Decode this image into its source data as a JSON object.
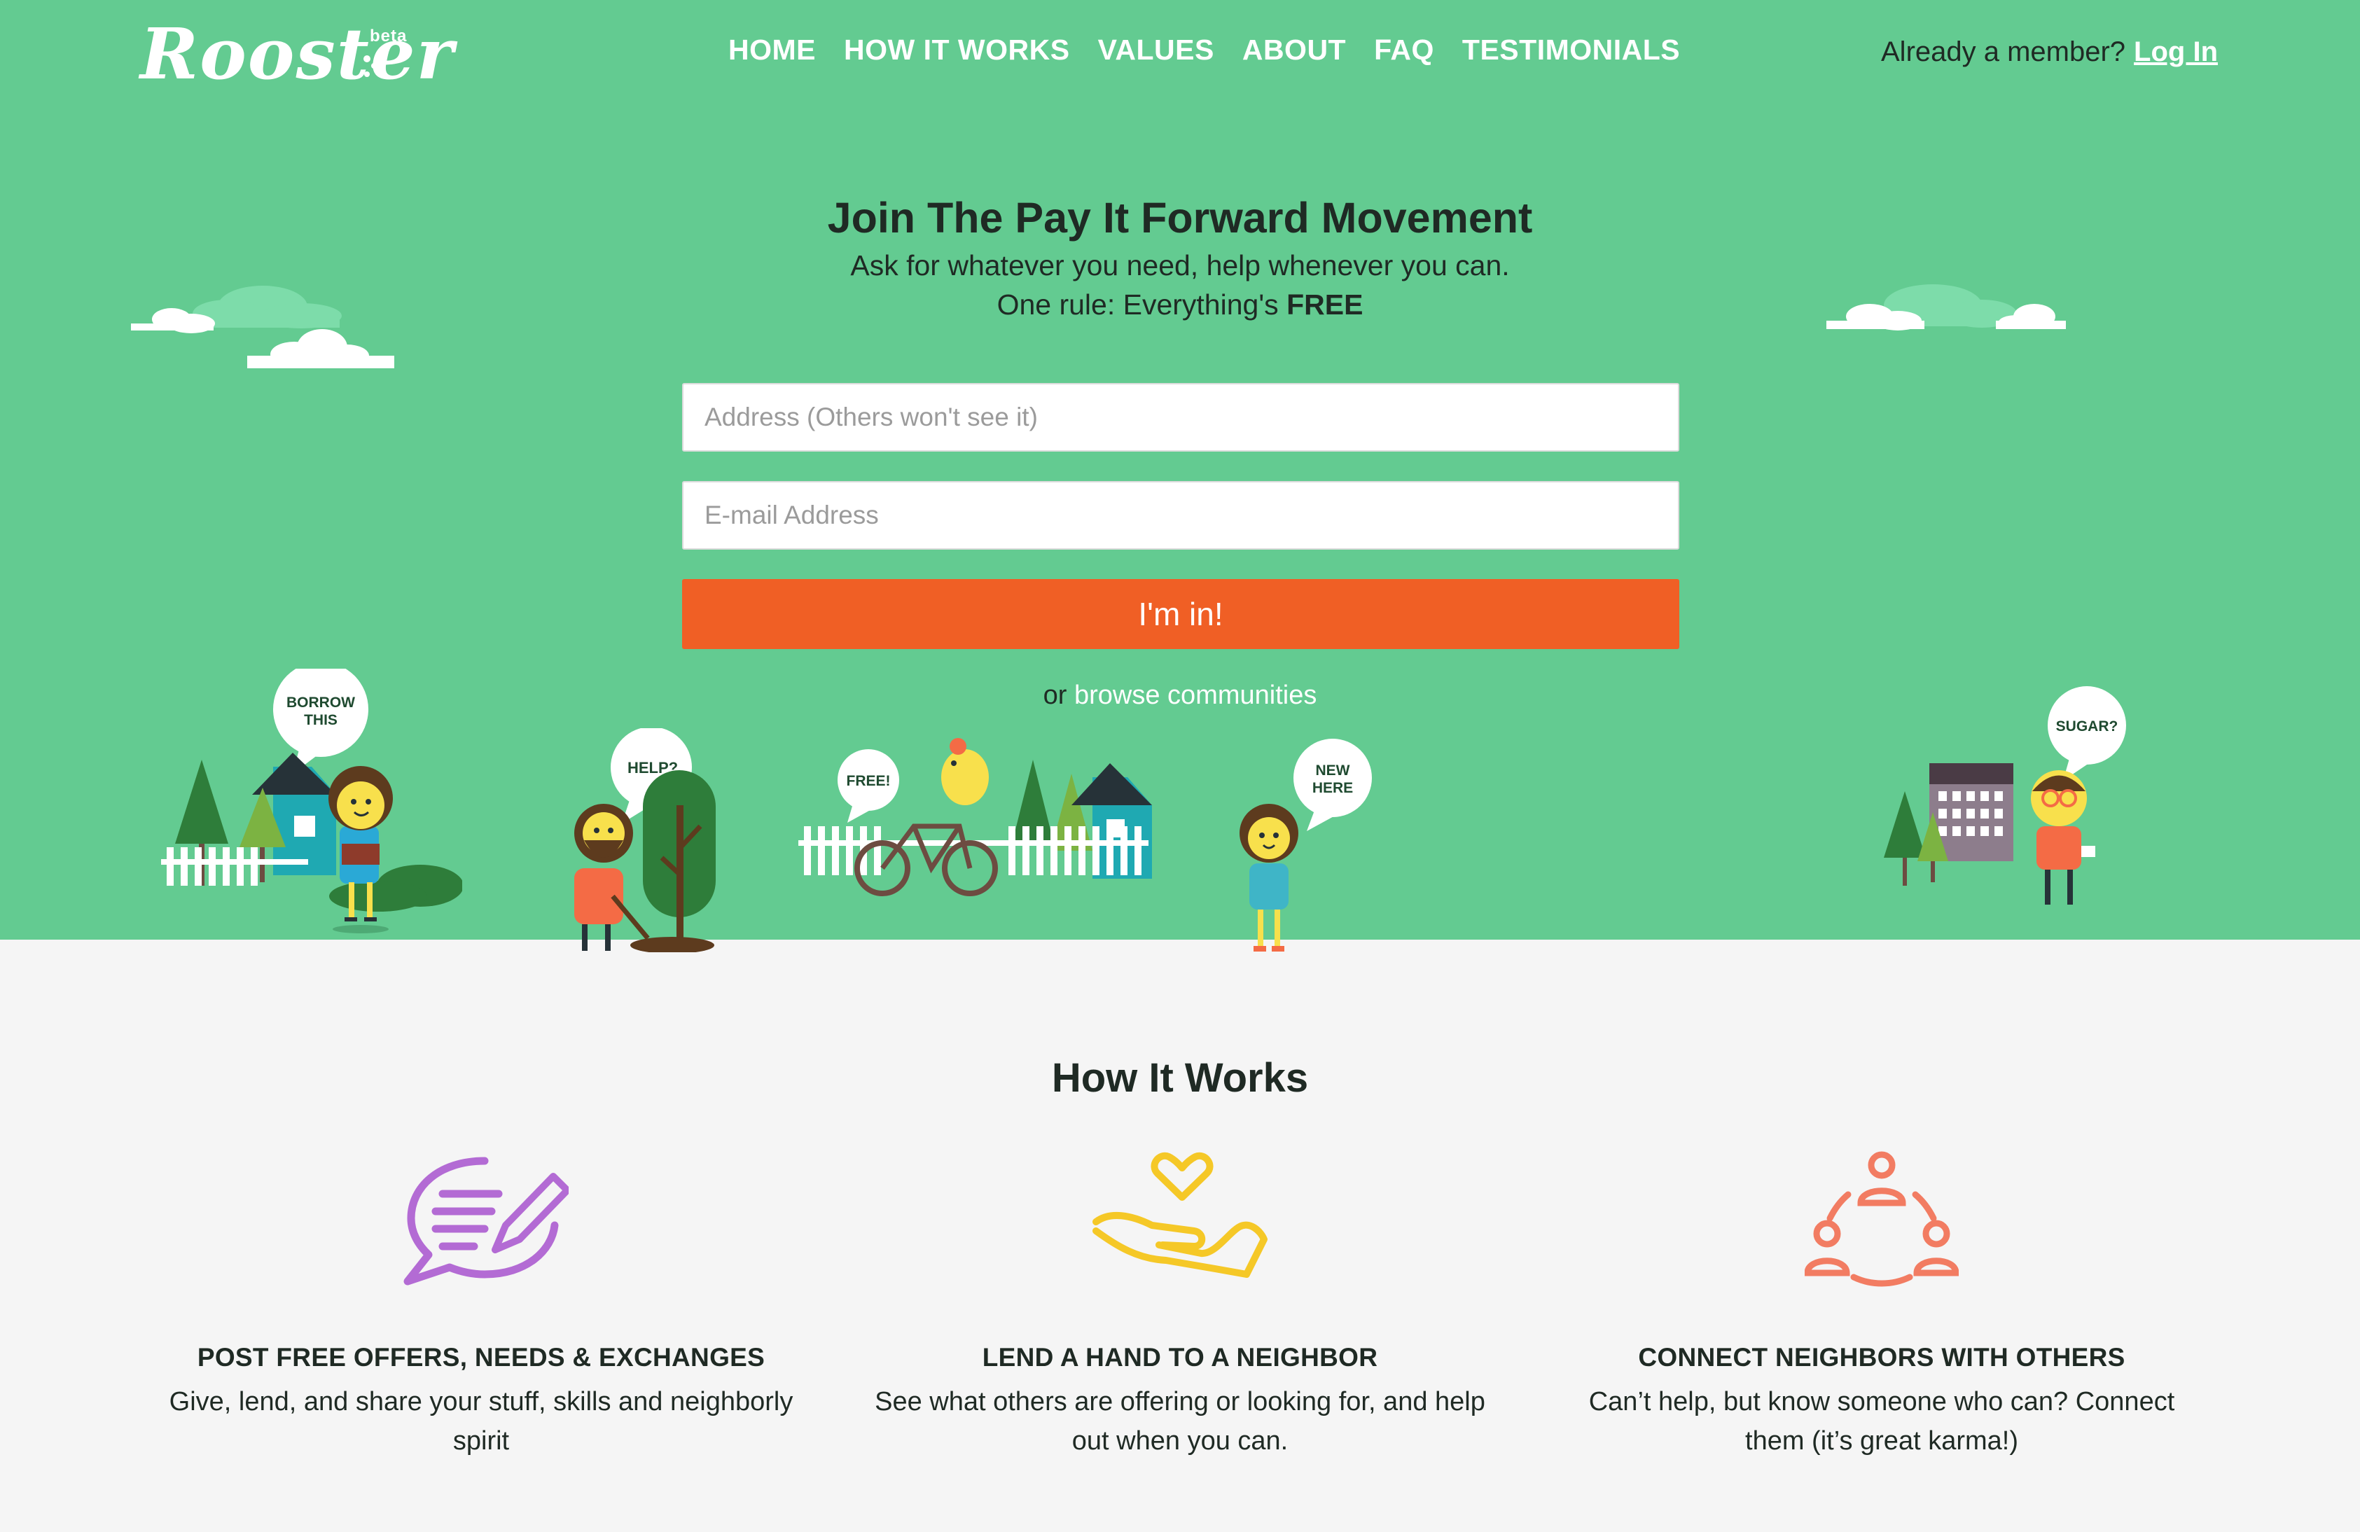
{
  "brand": {
    "name": "Rooster",
    "badge": "beta"
  },
  "nav": [
    {
      "label": "HOME"
    },
    {
      "label": "HOW IT WORKS"
    },
    {
      "label": "VALUES"
    },
    {
      "label": "ABOUT"
    },
    {
      "label": "FAQ"
    },
    {
      "label": "TESTIMONIALS"
    }
  ],
  "member": {
    "prompt": "Already a member?",
    "login": "Log In"
  },
  "hero": {
    "headline": "Join The Pay It Forward Movement",
    "subline": "Ask for whatever you need, help whenever you can.",
    "rule_prefix": "One rule: Everything's",
    "rule_emphasis": "FREE",
    "address_placeholder": "Address (Others won't see it)",
    "email_placeholder": "E-mail Address",
    "cta": "I'm in!",
    "browse_prefix": "or",
    "browse_link": "browse communities"
  },
  "bubbles": {
    "borrow": [
      "BORROW",
      "THIS"
    ],
    "help": "HELP?",
    "free": "FREE!",
    "new_here": [
      "NEW",
      "HERE"
    ],
    "sugar": "SUGAR?"
  },
  "how": {
    "title": "How It Works",
    "features": [
      {
        "icon": "chat-pencil-icon",
        "title": "POST FREE OFFERS, NEEDS & EXCHANGES",
        "text": "Give, lend, and share your stuff, skills and neighborly spirit"
      },
      {
        "icon": "hand-heart-icon",
        "title": "LEND A HAND TO A NEIGHBOR",
        "text": "See what others are offering or looking for, and help out when you can."
      },
      {
        "icon": "people-network-icon",
        "title": "CONNECT NEIGHBORS WITH OTHERS",
        "text": "Can’t help, but know someone who can? Connect them (it’s great karma!)"
      }
    ]
  },
  "colors": {
    "hero_bg": "#63cb91",
    "page_bg": "#f5f5f5",
    "cta": "#f05f25",
    "icon_purple": "#b36bd4",
    "icon_yellow": "#f5c827",
    "icon_coral": "#f27c62"
  }
}
